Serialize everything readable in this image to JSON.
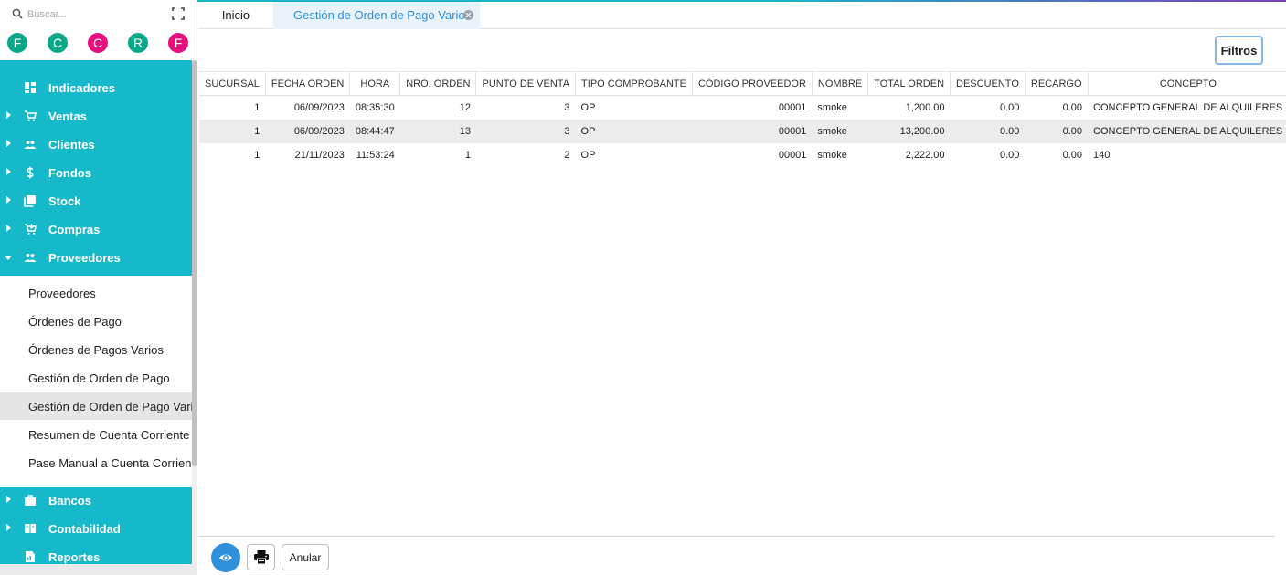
{
  "search": {
    "placeholder": "Buscar..."
  },
  "avatars": [
    {
      "letter": "F",
      "color": "#0aa88a"
    },
    {
      "letter": "C",
      "color": "#0aa88a"
    },
    {
      "letter": "C",
      "color": "#e8107e"
    },
    {
      "letter": "R",
      "color": "#0aa88a"
    },
    {
      "letter": "F",
      "color": "#e8107e"
    }
  ],
  "sidebar": {
    "menu": [
      {
        "label": "Indicadores",
        "icon": "dashboard-icon"
      },
      {
        "label": "Ventas",
        "icon": "cart-icon"
      },
      {
        "label": "Clientes",
        "icon": "people-icon"
      },
      {
        "label": "Fondos",
        "icon": "dollar-icon"
      },
      {
        "label": "Stock",
        "icon": "stock-icon"
      },
      {
        "label": "Compras",
        "icon": "shopping-icon"
      },
      {
        "label": "Proveedores",
        "icon": "people-icon"
      }
    ],
    "submenu": [
      {
        "label": "Proveedores"
      },
      {
        "label": "Órdenes de Pago"
      },
      {
        "label": "Órdenes de Pagos Varios"
      },
      {
        "label": "Gestión de Orden de Pago"
      },
      {
        "label": "Gestión de Orden de Pago Varios",
        "active": true
      },
      {
        "label": "Resumen de Cuenta Corriente"
      },
      {
        "label": "Pase Manual a Cuenta Corriente"
      }
    ],
    "menu_bottom": [
      {
        "label": "Bancos",
        "icon": "briefcase-icon"
      },
      {
        "label": "Contabilidad",
        "icon": "book-icon"
      },
      {
        "label": "Reportes",
        "icon": "report-icon"
      }
    ]
  },
  "tabs": [
    {
      "label": "Inicio"
    },
    {
      "label": "Gestión de Orden de Pago Varios"
    }
  ],
  "toolbar": {
    "filtros_label": "Filtros",
    "anular_label": "Anular"
  },
  "table": {
    "columns": [
      "SUCURSAL",
      "FECHA ORDEN",
      "HORA",
      "NRO. ORDEN",
      "PUNTO DE VENTA",
      "TIPO COMPROBANTE",
      "CÓDIGO PROVEEDOR",
      "NOMBRE",
      "TOTAL ORDEN",
      "DESCUENTO",
      "RECARGO",
      "CONCEPTO"
    ],
    "rows": [
      [
        "1",
        "06/09/2023",
        "08:35:30",
        "12",
        "3",
        "OP",
        "00001",
        "smoke",
        "1,200.00",
        "0.00",
        "0.00",
        "CONCEPTO GENERAL DE ALQUILERES"
      ],
      [
        "1",
        "06/09/2023",
        "08:44:47",
        "13",
        "3",
        "OP",
        "00001",
        "smoke",
        "13,200.00",
        "0.00",
        "0.00",
        "CONCEPTO GENERAL DE ALQUILERES"
      ],
      [
        "1",
        "21/11/2023",
        "11:53:24",
        "1",
        "2",
        "OP",
        "00001",
        "smoke",
        "2,222.00",
        "0.00",
        "0.00",
        "140"
      ]
    ]
  }
}
